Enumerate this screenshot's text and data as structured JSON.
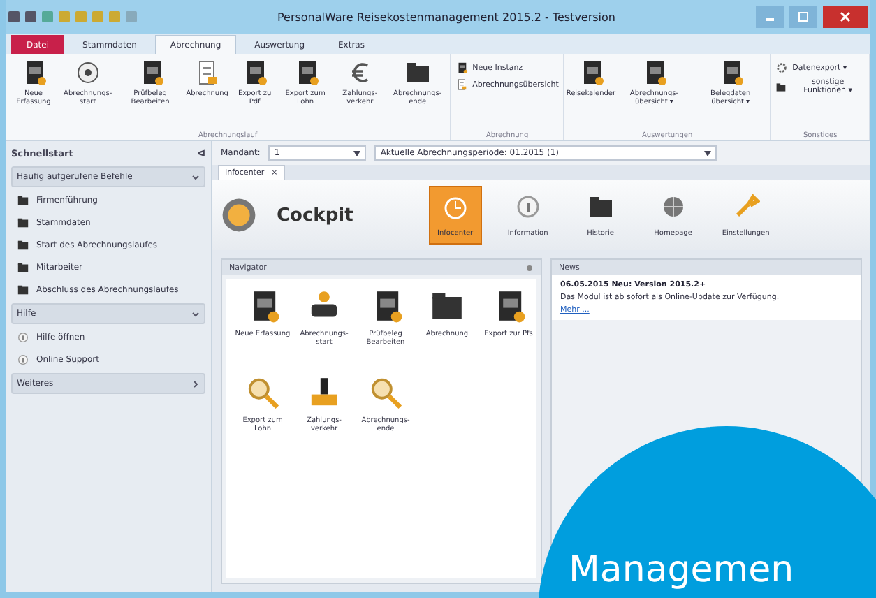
{
  "window": {
    "title": "PersonalWare Reisekostenmanagement 2015.2 - Testversion"
  },
  "ribbon_tabs": [
    {
      "label": "Datei",
      "kind": "file",
      "selected": false
    },
    {
      "label": "Stammdaten",
      "kind": "tab",
      "selected": false
    },
    {
      "label": "Abrechnung",
      "kind": "tab",
      "selected": true
    },
    {
      "label": "Auswertung",
      "kind": "tab",
      "selected": false
    },
    {
      "label": "Extras",
      "kind": "tab",
      "selected": false
    }
  ],
  "ribbon_groups": [
    {
      "label": "Abrechnungslauf",
      "items": [
        {
          "kind": "large",
          "label": "Neue Erfassung"
        },
        {
          "kind": "large",
          "label": "Abrechnungs-start"
        },
        {
          "kind": "large",
          "label": "Prüfbeleg Bearbeiten"
        },
        {
          "kind": "large",
          "label": "Abrechnung"
        },
        {
          "kind": "large",
          "label": "Export zu Pdf"
        },
        {
          "kind": "large",
          "label": "Export zum Lohn"
        },
        {
          "kind": "large",
          "label": "Zahlungs-verkehr"
        },
        {
          "kind": "large",
          "label": "Abrechnungs-ende"
        }
      ]
    },
    {
      "label": "Abrechnung",
      "items": [
        {
          "kind": "small",
          "label": "Neue Instanz"
        },
        {
          "kind": "small",
          "label": "Abrechnungsübersicht"
        }
      ]
    },
    {
      "label": "Auswertungen",
      "items": [
        {
          "kind": "large",
          "label": "Reisekalender"
        },
        {
          "kind": "large",
          "label": "Abrechnungs-übersicht ▾"
        },
        {
          "kind": "large",
          "label": "Belegdaten übersicht ▾"
        }
      ]
    },
    {
      "label": "Sonstiges",
      "items": [
        {
          "kind": "small",
          "label": "Datenexport ▾"
        },
        {
          "kind": "small",
          "label": "sonstige Funktionen ▾"
        }
      ]
    }
  ],
  "sidebar": {
    "title": "Schnellstart",
    "pin": "ᐊ",
    "groups": [
      {
        "label": "Häufig aufgerufene Befehle",
        "expanded": true,
        "items": [
          "Firmenführung",
          "Stammdaten",
          "Start des Abrechnungslaufes",
          "Mitarbeiter",
          "Abschluss des Abrechnungslaufes"
        ]
      },
      {
        "label": "Hilfe",
        "expanded": true,
        "items": [
          "Hilfe öffnen",
          "Online Support"
        ]
      },
      {
        "label": "Weiteres",
        "expanded": false
      }
    ]
  },
  "toolbar": {
    "mandant_label": "Mandant:",
    "mandant_value": "1",
    "period_label": "Aktuelle Abrechnungsperiode: 01.2015 (1)"
  },
  "document_tabs": [
    {
      "label": "Infocenter",
      "selected": true,
      "close": "×"
    }
  ],
  "cockpit": {
    "title": "Cockpit",
    "tiles": [
      {
        "label": "Infocenter",
        "selected": true
      },
      {
        "label": "Information",
        "selected": false
      },
      {
        "label": "Historie",
        "selected": false
      },
      {
        "label": "Homepage",
        "selected": false
      },
      {
        "label": "Einstellungen",
        "selected": false
      }
    ]
  },
  "navigator": {
    "title": "Navigator",
    "items": [
      "Neue Erfassung",
      "Abrechnungs-start",
      "Prüfbeleg Bearbeiten",
      "Abrechnung",
      "Export zur Pfs",
      "Export zum Lohn",
      "Zahlungs-verkehr",
      "Abrechnungs-ende"
    ]
  },
  "news": {
    "title": "News",
    "headline": "06.05.2015 Neu: Version 2015.2+",
    "body": "Das Modul ist ab sofort als Online-Update zur Verfügung.",
    "link": "Mehr ..."
  },
  "overlay": {
    "text": "Managemen"
  }
}
